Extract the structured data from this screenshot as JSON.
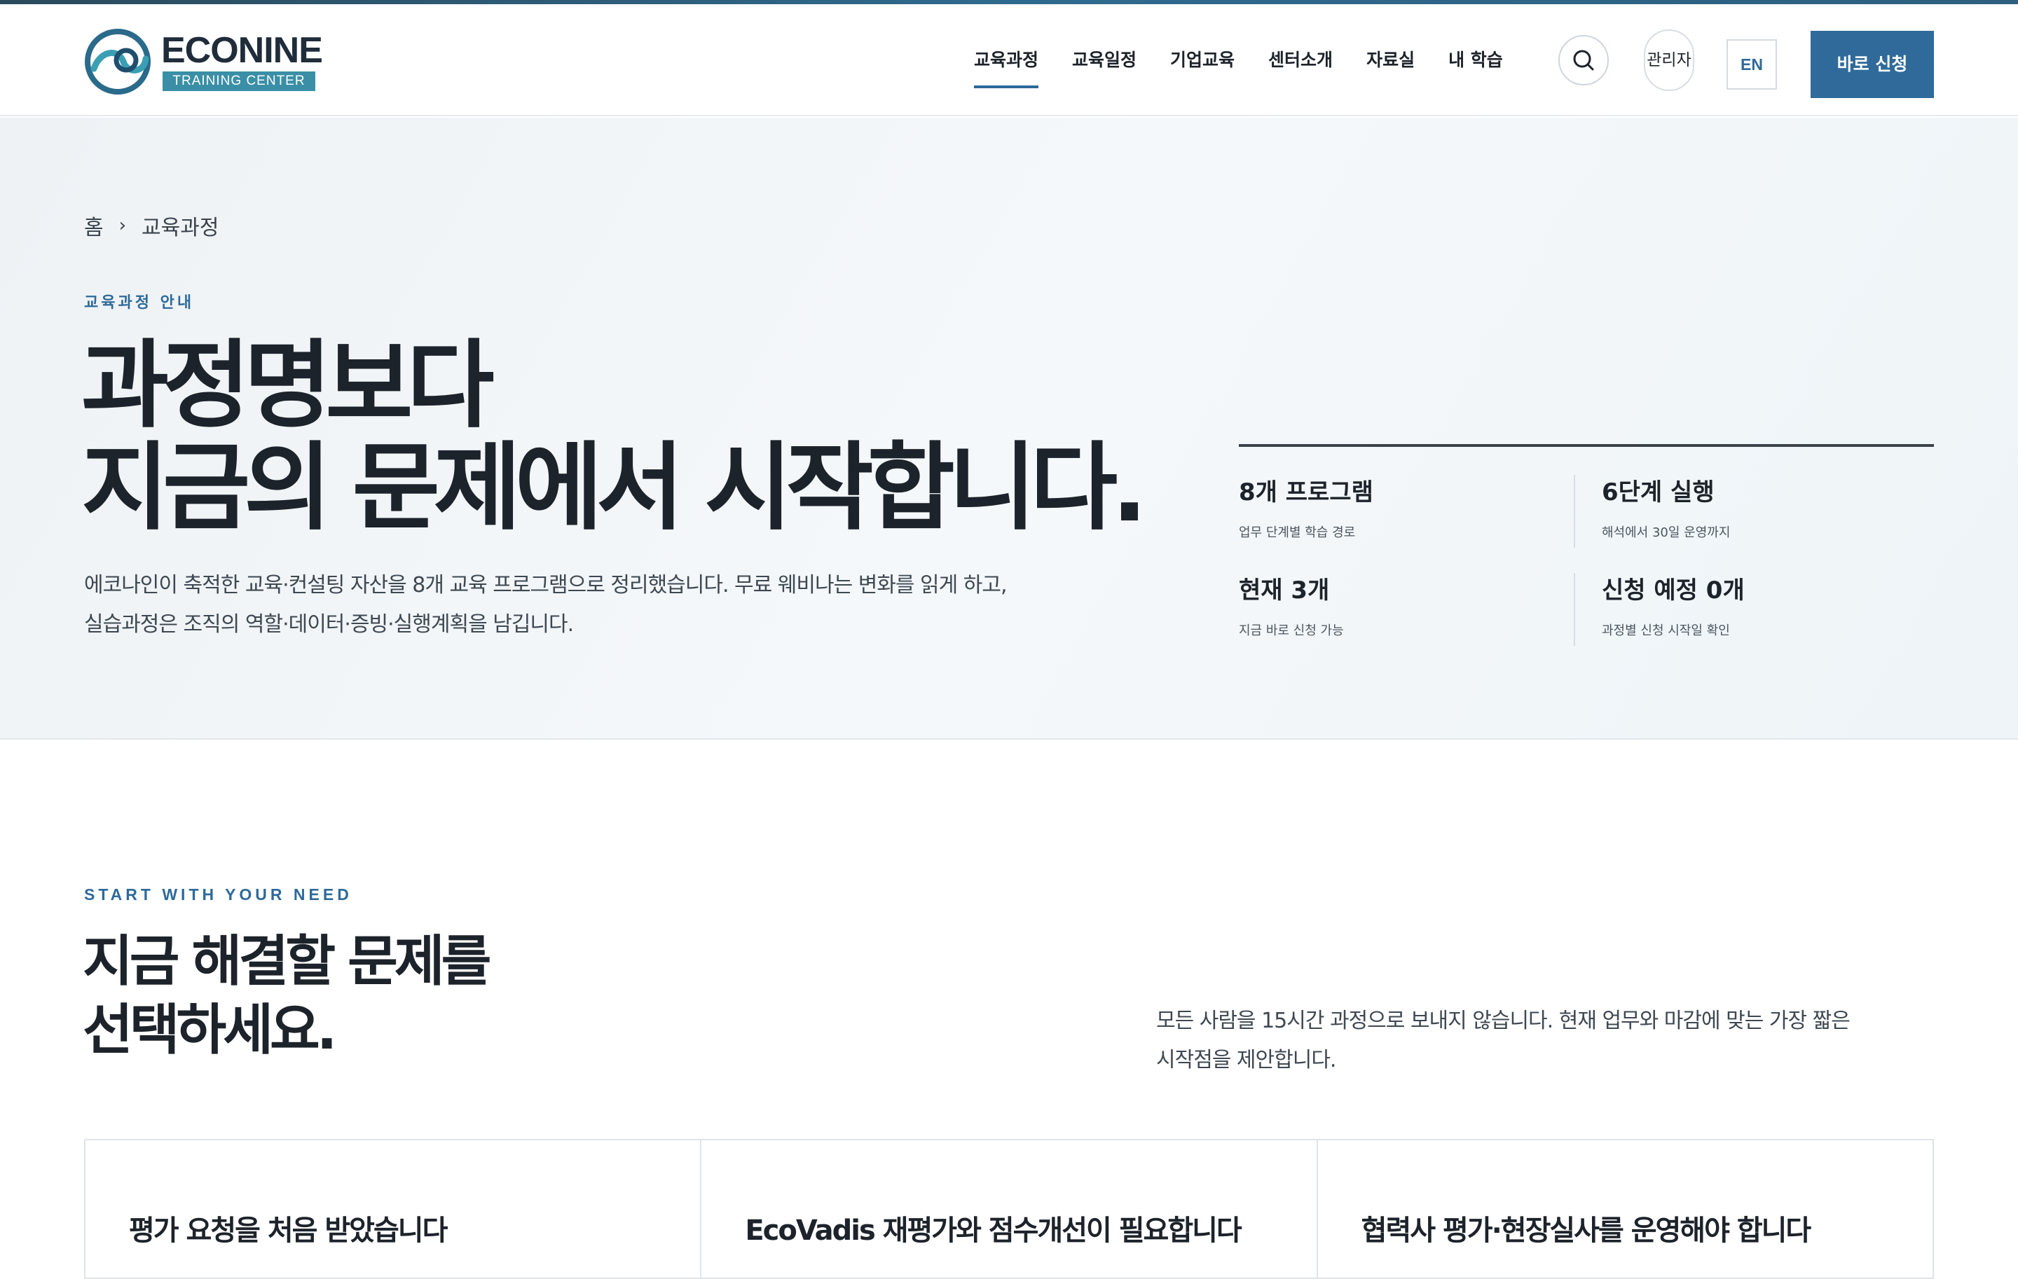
{
  "brand": {
    "name": "ECONINE",
    "subtitle": "TRAINING CENTER",
    "colors": {
      "primary": "#2f6a9a",
      "accent": "#3a8fa6",
      "text": "#1d232a"
    }
  },
  "nav": {
    "items": [
      {
        "label": "교육과정",
        "active": true
      },
      {
        "label": "교육일정"
      },
      {
        "label": "기업교육"
      },
      {
        "label": "센터소개"
      },
      {
        "label": "자료실"
      },
      {
        "label": "내 학습"
      }
    ],
    "search_icon": "search-icon",
    "admin_label": "관리자",
    "lang_label": "EN",
    "apply_label": "바로 신청"
  },
  "hero": {
    "breadcrumb": {
      "home": "홈",
      "separator": "›",
      "current": "교육과정"
    },
    "eyebrow": "교육과정 안내",
    "title_line1": "과정명보다",
    "title_line2": "지금의 문제에서 시작합니다.",
    "desc_line1": "에코나인이 축적한 교육·컨설팅 자산을 8개 교육 프로그램으로 정리했습니다. 무료 웨비나는 변화를 읽게 하고,",
    "desc_line2": "실습과정은 조직의 역할·데이터·증빙·실행계획을 남깁니다.",
    "stats": [
      {
        "value": "8개 프로그램",
        "label": "업무 단계별 학습 경로"
      },
      {
        "value": "6단계 실행",
        "label": "해석에서 30일 운영까지"
      },
      {
        "value": "현재 3개",
        "label": "지금 바로 신청 가능"
      },
      {
        "value": "신청 예정 0개",
        "label": "과정별 신청 시작일 확인"
      }
    ]
  },
  "need": {
    "eyebrow": "START WITH YOUR NEED",
    "title_line1": "지금 해결할 문제를",
    "title_line2": "선택하세요.",
    "desc_line1": "모든 사람을 15시간 과정으로 보내지 않습니다. 현재 업무와 마감에 맞는 가장 짧은",
    "desc_line2": "시작점을 제안합니다.",
    "cards": [
      {
        "title": "평가 요청을 처음 받았습니다"
      },
      {
        "title": "EcoVadis 재평가와 점수개선이 필요합니다"
      },
      {
        "title": "협력사 평가·현장실사를 운영해야 합니다"
      }
    ]
  }
}
